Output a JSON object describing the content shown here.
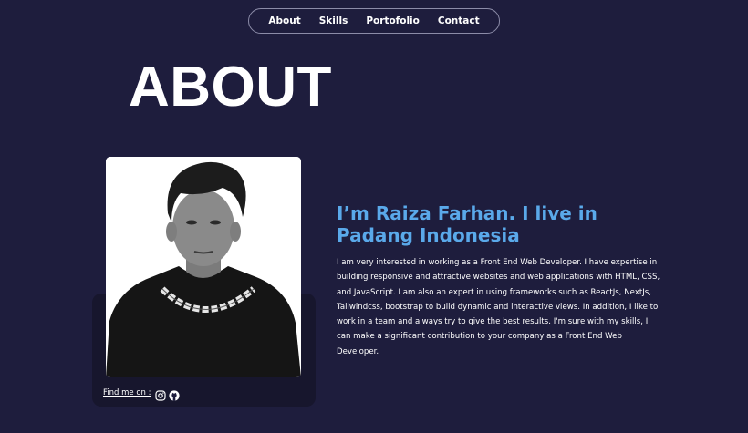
{
  "nav": {
    "items": [
      {
        "label": "About"
      },
      {
        "label": "Skills"
      },
      {
        "label": "Portofolio"
      },
      {
        "label": "Contact"
      }
    ]
  },
  "page_title": "ABOUT",
  "profile": {
    "photo_alt": "Portrait photo",
    "find_me_label": "Find me on :",
    "social_icons": [
      "instagram-icon",
      "github-icon"
    ]
  },
  "about": {
    "headline": "I’m Raiza Farhan. I live in Padang Indonesia",
    "bio": "I am very interested in working as a Front End Web Developer. I have expertise in building responsive and attractive websites and web applications with HTML, CSS, and JavaScript. I am also an expert in using frameworks such as ReactJs, NextJs, Tailwindcss, bootstrap to build dynamic and interactive views. In addition, I like to work in a team and always try to give the best results. I'm sure with my skills, I can make a significant contribution to your company as a Front End Web Developer."
  },
  "colors": {
    "background": "#1e1d3d",
    "accent": "#5aa9ea",
    "card": "#17162d"
  }
}
